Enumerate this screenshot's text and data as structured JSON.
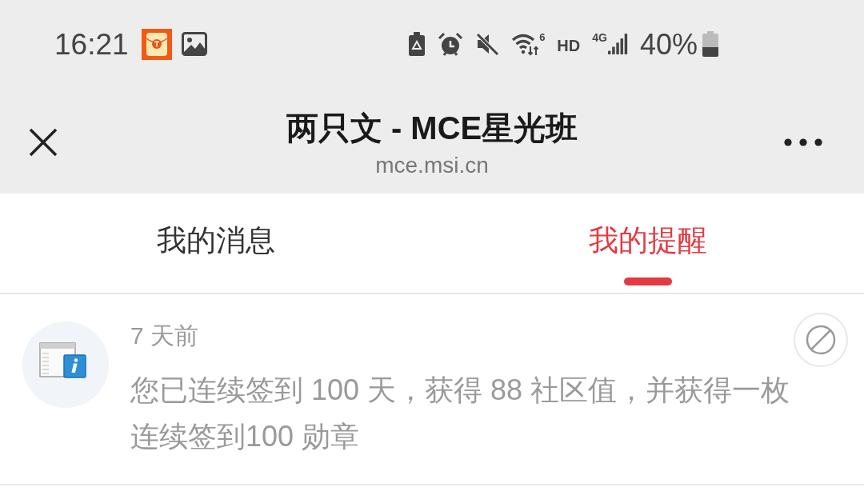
{
  "status_bar": {
    "time": "16:21",
    "wifi_label": "6",
    "hd_label": "HD",
    "network_label": "4G",
    "battery_percent": "40%"
  },
  "header": {
    "title": "两只文 - MCE星光班",
    "url": "mce.msi.cn"
  },
  "tabs": [
    {
      "label": "我的消息",
      "selected": false
    },
    {
      "label": "我的提醒",
      "selected": true
    }
  ],
  "notifications": [
    {
      "time": "7 天前",
      "text": "您已连续签到 100 天，获得 88 社区值，并获得一枚连续签到100 勋章"
    }
  ]
}
